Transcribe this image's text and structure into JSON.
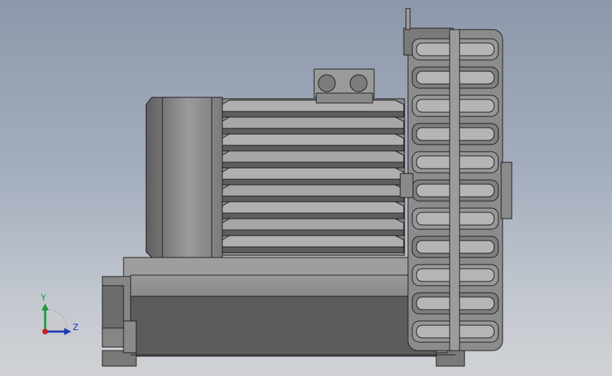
{
  "viewport": {
    "background_top": "#8d98aa",
    "background_bottom": "#d0d2d5"
  },
  "model": {
    "body_color": "#8a8a8a",
    "edge_color": "#1a1a1a"
  },
  "triad": {
    "y_label": "Y",
    "z_label": "Z",
    "y_color": "#1a9a3a",
    "z_color": "#1a3ab5",
    "x_color": "#c8202a"
  }
}
